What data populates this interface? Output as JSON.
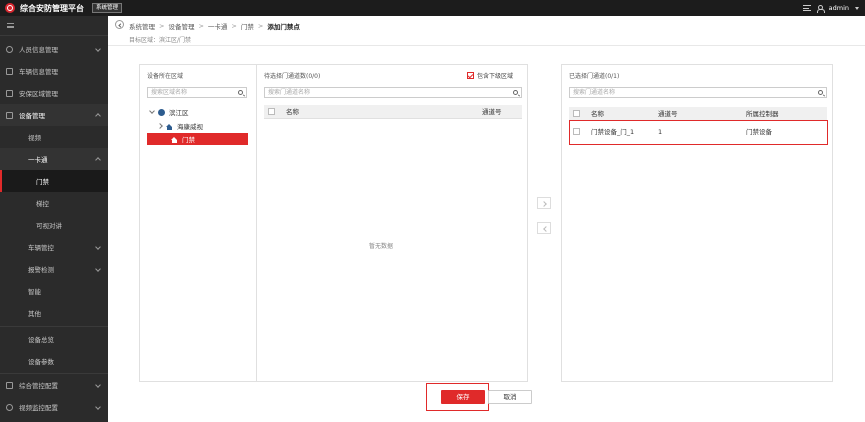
{
  "header": {
    "app_title": "综合安防管理平台",
    "system_button": "系统管理",
    "username": "admin"
  },
  "sidebar": {
    "items": [
      {
        "label": "人员信息管理"
      },
      {
        "label": "车辆信息管理"
      },
      {
        "label": "安保区域管理"
      },
      {
        "label": "设备管理"
      },
      {
        "label": "视频"
      },
      {
        "label": "一卡通"
      },
      {
        "label": "门禁"
      },
      {
        "label": "梯控"
      },
      {
        "label": "可视对讲"
      },
      {
        "label": "车辆管控"
      },
      {
        "label": "报警检测"
      },
      {
        "label": "智能"
      },
      {
        "label": "其他"
      },
      {
        "label": "设备总览"
      },
      {
        "label": "设备参数"
      },
      {
        "label": "综合管控配置"
      },
      {
        "label": "视频监控配置"
      }
    ]
  },
  "breadcrumb": {
    "items": [
      "系统管理",
      "设备管理",
      "一卡通",
      "门禁",
      "添加门禁点"
    ],
    "separator": ">"
  },
  "target_area": "目标区域：滨江区/门禁",
  "region_panel": {
    "title": "设备所在区域",
    "search_placeholder": "搜索区域名称",
    "tree": [
      {
        "label": "滨江区"
      },
      {
        "label": "海康威视"
      },
      {
        "label": "门禁"
      }
    ]
  },
  "pending_panel": {
    "title": "待选择门通道数(0/0)",
    "include_sub_label": "包含下级区域",
    "include_sub_checked": true,
    "search_placeholder": "搜索门通道名称",
    "columns": [
      "名称",
      "通道号"
    ],
    "empty_text": "暂无数据"
  },
  "selected_panel": {
    "title": "已选择门通道(0/1)",
    "search_placeholder": "搜索门通道名称",
    "columns": [
      "名称",
      "通道号",
      "所属控制器"
    ],
    "rows": [
      {
        "name": "门禁设备_门_1",
        "channel": "1",
        "controller": "门禁设备"
      }
    ]
  },
  "actions": {
    "save_label": "保存",
    "cancel_label": "取消"
  },
  "colors": {
    "accent": "#e02a2a",
    "topbar": "#1c1c1c",
    "sidebar": "#2b2b2b"
  }
}
